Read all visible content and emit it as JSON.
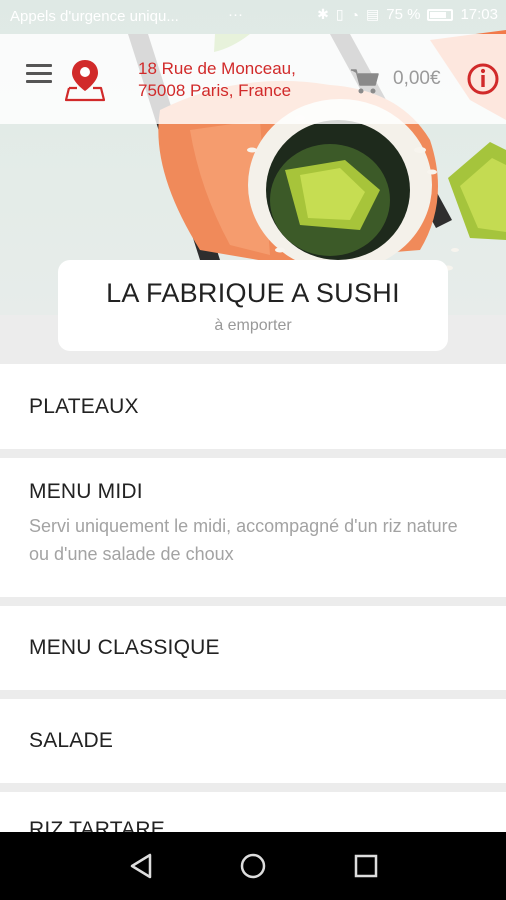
{
  "status_bar": {
    "notification": "Appels d'urgence uniqu...",
    "dots": "···",
    "battery": "75 %",
    "time": "17:03"
  },
  "header": {
    "address_line1": "18 Rue de Monceau,",
    "address_line2": "75008 Paris, France",
    "cart_total": "0,00€"
  },
  "restaurant": {
    "name": "LA FABRIQUE A SUSHI",
    "mode": "à emporter"
  },
  "categories": [
    {
      "title": "PLATEAUX"
    },
    {
      "title": "MENU MIDI",
      "description": "Servi uniquement le midi, accompagné d'un riz nature ou d'une salade de choux"
    },
    {
      "title": "MENU CLASSIQUE"
    },
    {
      "title": "SALADE"
    },
    {
      "title": "RIZ TARTARE"
    }
  ],
  "colors": {
    "accent": "#d12a2a",
    "price": "#9a9a9a",
    "card_bg": "#ffffff",
    "page_bg": "#ececec"
  },
  "icons": [
    "menu-icon",
    "location-map-icon",
    "cart-icon",
    "info-icon",
    "back-icon",
    "home-icon",
    "recents-icon"
  ]
}
